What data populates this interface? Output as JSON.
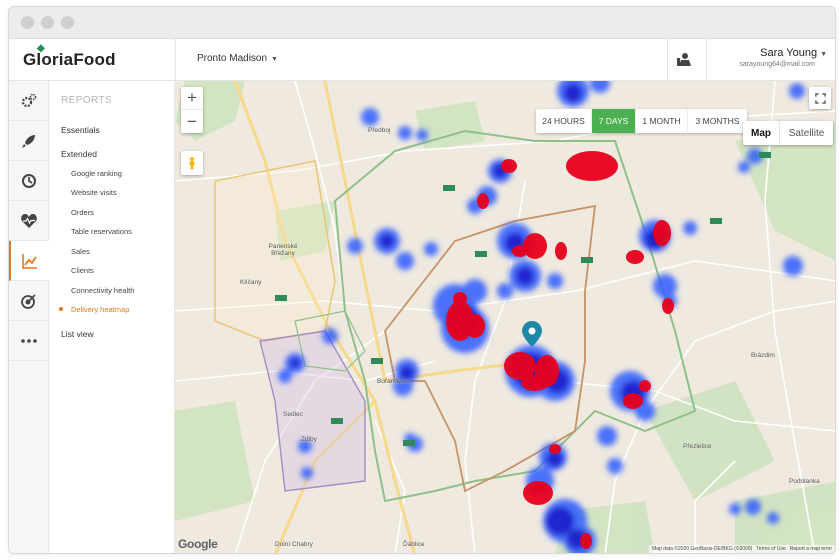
{
  "window": {
    "traffic_lights": 3
  },
  "header": {
    "logo": "GloriaFood",
    "restaurant": "Pronto Madison",
    "user_name": "Sara Young",
    "user_email": "sarayoung64@mail.com",
    "icons": {
      "assign": "assign-person-icon",
      "restaurant_caret": "chevron-down-icon",
      "user_caret": "chevron-down-icon"
    }
  },
  "iconbar": {
    "items": [
      {
        "name": "setup-icon",
        "label": "Setup"
      },
      {
        "name": "rocket-icon",
        "label": "Publishing"
      },
      {
        "name": "orders-cycle-icon",
        "label": "Orders"
      },
      {
        "name": "heart-pulse-icon",
        "label": "Marketing"
      },
      {
        "name": "reports-chart-icon",
        "label": "Reports"
      },
      {
        "name": "target-icon",
        "label": "Promotions"
      },
      {
        "name": "more-dots-icon",
        "label": "More"
      }
    ],
    "active_index": 4
  },
  "subnav": {
    "title": "REPORTS",
    "essentials": "Essentials",
    "extended": "Extended",
    "items": [
      "Google ranking",
      "Website visits",
      "Orders",
      "Table reservations",
      "Sales",
      "Clients",
      "Connectivity health",
      "Delivery heatmap"
    ],
    "current": "Delivery heatmap",
    "list_view": "List view"
  },
  "map": {
    "zoom_in": "+",
    "zoom_out": "−",
    "ranges": [
      "24 HOURS",
      "7 DAYS",
      "1 MONTH",
      "3 MONTHS"
    ],
    "active_range": "7 DAYS",
    "map_types": [
      "Map",
      "Satellite"
    ],
    "active_map_type": "Map",
    "places": [
      "Předboj",
      "Panenské Břežany",
      "Klíčany",
      "Bořanovice",
      "Brázdim",
      "Přezletice",
      "Podolanka",
      "Dolní Chabry",
      "Ďáblice",
      "Sedlec",
      "Zdiby"
    ],
    "google": "Google",
    "attribution": "Map data ©2020 GeoBasis-DE/BKG (©2009)",
    "terms": "Terms of Use",
    "report": "Report a map error",
    "colors": {
      "heat_high": "#e8001c",
      "heat_mid": "#1e1ec8",
      "heat_low": "#2e5cff",
      "range_active": "#4caf50"
    }
  }
}
